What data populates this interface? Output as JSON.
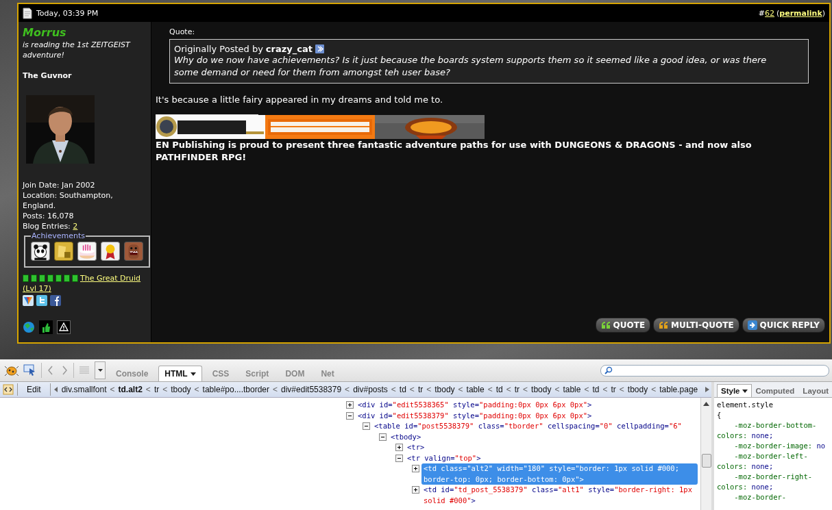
{
  "post": {
    "date": "Today, 03:39 PM",
    "number_prefix": "#",
    "number": "62",
    "permalink_open": "(",
    "permalink": "permalink",
    "permalink_close": ")",
    "user": {
      "name": "Morrus",
      "status": "is reading the 1st ZEITGEIST adventure!",
      "title": "The Guvnor",
      "info": [
        "Join Date: Jan 2002",
        "Location: Southampton, England.",
        "Posts: 16,078"
      ],
      "blog_label": "Blog Entries:",
      "blog_count": "2",
      "achievements_legend": "Achievements",
      "rank": "The Great Druid (Lvl 17)"
    },
    "quote": {
      "label": "Quote:",
      "prefix": "Originally Posted by",
      "author": "crazy_cat",
      "text": "Why do we now have achievements? Is it just because the boards system supports them so it seemed like a good idea, or was there some demand or need for them from amongst teh user base?"
    },
    "message": "It's because a little fairy appeared in my dreams and told me to.",
    "signature": {
      "text": "EN Publishing is proud to present three fantastic adventure paths for use with DUNGEONS & DRAGONS - and now also PATHFINDER RPG!"
    },
    "buttons": [
      {
        "label": "QUOTE",
        "kind": "quote"
      },
      {
        "label": "MULTI-QUOTE",
        "kind": "multi"
      },
      {
        "label": "QUICK REPLY",
        "kind": "reply"
      }
    ]
  },
  "devtools": {
    "tabs": [
      {
        "label": "Console",
        "selected": false,
        "menu": false
      },
      {
        "label": "HTML",
        "selected": true,
        "menu": true
      },
      {
        "label": "CSS",
        "selected": false,
        "menu": false
      },
      {
        "label": "Script",
        "selected": false,
        "menu": false
      },
      {
        "label": "DOM",
        "selected": false,
        "menu": false
      },
      {
        "label": "Net",
        "selected": false,
        "menu": false
      }
    ],
    "edit": "Edit",
    "breadcrumbs": [
      {
        "label": "div.smallfont",
        "selected": false
      },
      {
        "label": "td.alt2",
        "selected": true
      },
      {
        "label": "tr",
        "selected": false
      },
      {
        "label": "tbody",
        "selected": false
      },
      {
        "label": "table#po....tborder",
        "selected": false
      },
      {
        "label": "div#edit5538379",
        "selected": false
      },
      {
        "label": "div#posts",
        "selected": false
      },
      {
        "label": "td",
        "selected": false
      },
      {
        "label": "tr",
        "selected": false
      },
      {
        "label": "tbody",
        "selected": false
      },
      {
        "label": "table",
        "selected": false
      },
      {
        "label": "td",
        "selected": false
      },
      {
        "label": "tr",
        "selected": false
      },
      {
        "label": "tbody",
        "selected": false
      },
      {
        "label": "table",
        "selected": false
      },
      {
        "label": "td",
        "selected": false
      },
      {
        "label": "tr",
        "selected": false
      },
      {
        "label": "tbody",
        "selected": false
      },
      {
        "label": "table.page",
        "selected": false
      }
    ],
    "separator": "<",
    "tree": [
      {
        "segments": [
          {
            "text": "<div id=",
            "kind": "markup"
          },
          {
            "text": "\"edit5538365\"",
            "kind": "value"
          },
          {
            "text": " style=",
            "kind": "markup"
          },
          {
            "text": "\"padding:0px 0px 6px 0px\"",
            "kind": "value"
          },
          {
            "text": ">",
            "kind": "markup"
          }
        ],
        "expanded": false,
        "selected": false
      },
      {
        "segments": [
          {
            "text": "<div id=",
            "kind": "markup"
          },
          {
            "text": "\"edit5538379\"",
            "kind": "value"
          },
          {
            "text": " style=",
            "kind": "markup"
          },
          {
            "text": "\"padding:0px 0px 6px 0px\"",
            "kind": "value"
          },
          {
            "text": ">",
            "kind": "markup"
          }
        ],
        "expanded": true,
        "selected": false,
        "children": [
          {
            "segments": [
              {
                "text": "<table id=",
                "kind": "markup"
              },
              {
                "text": "\"post5538379\"",
                "kind": "value"
              },
              {
                "text": " class=",
                "kind": "markup"
              },
              {
                "text": "\"tborder\"",
                "kind": "value"
              },
              {
                "text": " cellspacing=",
                "kind": "markup"
              },
              {
                "text": "\"0\"",
                "kind": "value"
              },
              {
                "text": " cellpadding=",
                "kind": "markup"
              },
              {
                "text": "\"6\"",
                "kind": "value"
              }
            ],
            "expanded": true,
            "selected": false,
            "children": [
              {
                "segments": [
                  {
                    "text": "<tbody>",
                    "kind": "markup"
                  }
                ],
                "expanded": true,
                "selected": false,
                "children": [
                  {
                    "segments": [
                      {
                        "text": "<tr>",
                        "kind": "markup"
                      }
                    ],
                    "expanded": false,
                    "selected": false
                  },
                  {
                    "segments": [
                      {
                        "text": "<tr valign=",
                        "kind": "markup"
                      },
                      {
                        "text": "\"top\"",
                        "kind": "value"
                      },
                      {
                        "text": ">",
                        "kind": "markup"
                      }
                    ],
                    "expanded": true,
                    "selected": false,
                    "children": [
                      {
                        "segments": [
                          {
                            "text": "<td class=",
                            "kind": "markup"
                          },
                          {
                            "text": "\"alt2\"",
                            "kind": "value"
                          },
                          {
                            "text": " width=",
                            "kind": "markup"
                          },
                          {
                            "text": "\"180\"",
                            "kind": "value"
                          },
                          {
                            "text": " style=",
                            "kind": "markup"
                          },
                          {
                            "text": "\"border: 1px solid #000; border-top: 0px; border-bottom: 0px\"",
                            "kind": "value"
                          },
                          {
                            "text": ">",
                            "kind": "markup"
                          }
                        ],
                        "expanded": false,
                        "selected": true
                      },
                      {
                        "segments": [
                          {
                            "text": "<td id=",
                            "kind": "markup"
                          },
                          {
                            "text": "\"td_post_5538379\"",
                            "kind": "value"
                          },
                          {
                            "text": " class=",
                            "kind": "markup"
                          },
                          {
                            "text": "\"alt1\"",
                            "kind": "value"
                          },
                          {
                            "text": " style=",
                            "kind": "markup"
                          },
                          {
                            "text": "\"border-right: 1px solid #000\"",
                            "kind": "value"
                          },
                          {
                            "text": ">",
                            "kind": "markup"
                          }
                        ],
                        "expanded": false,
                        "selected": false
                      }
                    ]
                  }
                ]
              }
            ]
          }
        ]
      }
    ],
    "side_tabs": [
      {
        "label": "Style",
        "selected": true,
        "menu": true
      },
      {
        "label": "Computed",
        "selected": false,
        "menu": false
      },
      {
        "label": "Layout",
        "selected": false,
        "menu": false
      }
    ],
    "css": {
      "selector": "element.style",
      "open": "{",
      "declarations": [
        {
          "property": "-moz-border-bottom-colors:",
          "value": "none;"
        },
        {
          "property": "-moz-border-image:",
          "value": "no"
        },
        {
          "property": "-moz-border-left-colors:",
          "value": "none;"
        },
        {
          "property": "-moz-border-right-colors:",
          "value": "none;"
        },
        {
          "property": "-moz-border-"
        }
      ]
    }
  }
}
